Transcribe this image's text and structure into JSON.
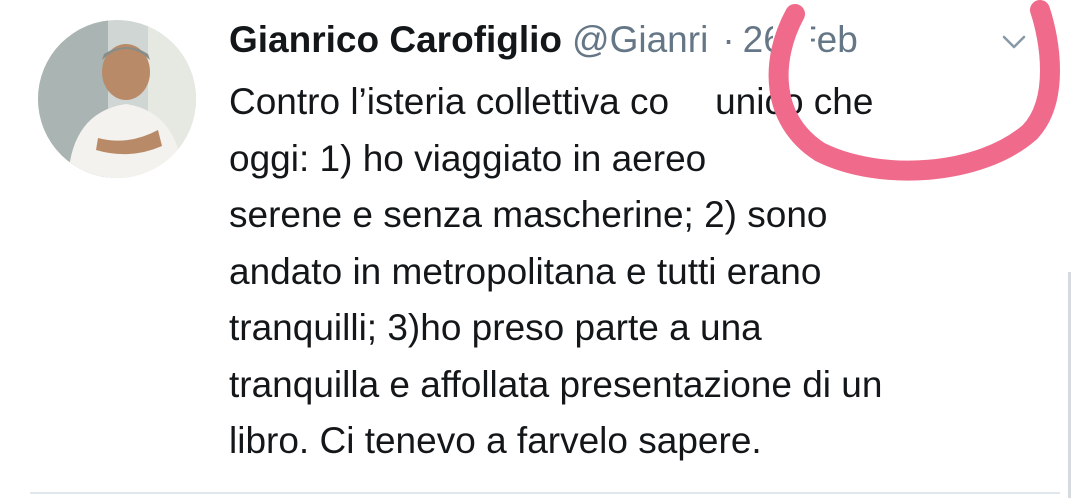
{
  "tweet": {
    "author_name": "Gianrico Carofiglio",
    "handle": "@Gianri",
    "separator": "·",
    "date": "26 Feb",
    "text_lines": [
      "Contro l’isteria collettiva co",
      "unico che",
      "oggi: 1) ho viaggiato in aereo",
      "serene e senza mascherine; 2) sono",
      "andato in metropolitana e tutti erano",
      "tranquilli; 3)ho preso parte a una",
      "tranquilla e affollata presentazione di un",
      "libro. Ci tenevo a farvelo sapere."
    ]
  },
  "icons": {
    "more": "chevron-down-icon",
    "avatar": "avatar-photo"
  },
  "colors": {
    "text": "#14171a",
    "secondary": "#657786",
    "annotation": "#f06a8c"
  }
}
